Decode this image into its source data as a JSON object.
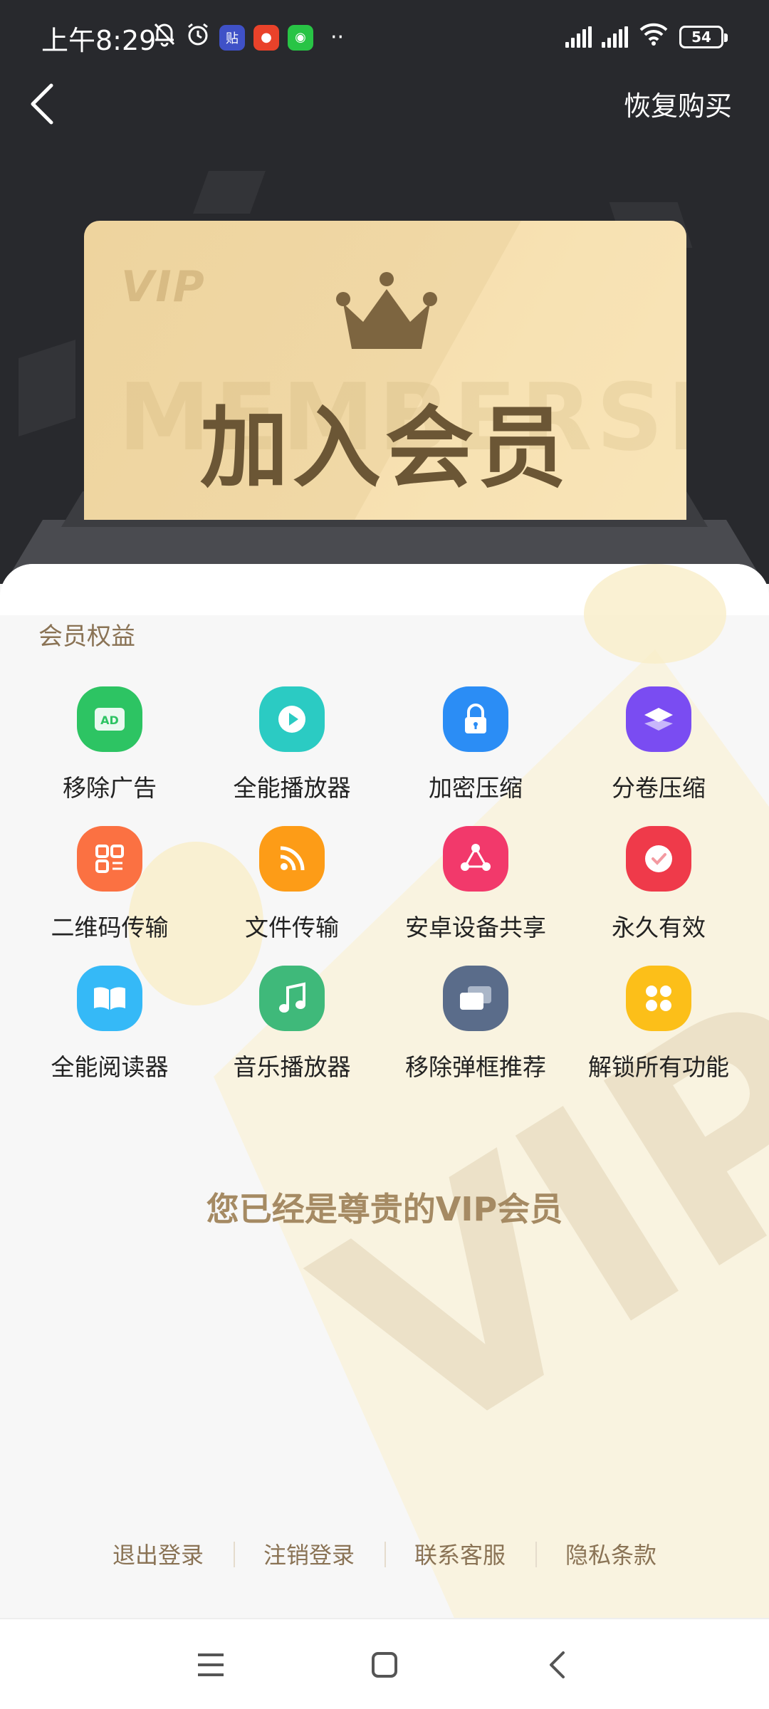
{
  "status_bar": {
    "time": "上午8:29",
    "battery": "54",
    "app_icons": [
      "bell-off-icon",
      "alarm-icon",
      "tieba-icon",
      "game-icon",
      "wechat-icon"
    ],
    "more": "··"
  },
  "header": {
    "restore_label": "恢复购买"
  },
  "vip_card": {
    "tag": "VIP",
    "watermark": "MEMBERSHIP",
    "title": "加入会员"
  },
  "benefits": {
    "title": "会员权益",
    "items": [
      {
        "label": "移除广告",
        "icon": "ad-icon",
        "color": "#2dc463"
      },
      {
        "label": "全能播放器",
        "icon": "play-icon",
        "color": "#2bcbc3"
      },
      {
        "label": "加密压缩",
        "icon": "lock-icon",
        "color": "#2b8df5"
      },
      {
        "label": "分卷压缩",
        "icon": "layers-icon",
        "color": "#7a4cf2"
      },
      {
        "label": "二维码传输",
        "icon": "qr-code-icon",
        "color": "#fb7142"
      },
      {
        "label": "文件传输",
        "icon": "rss-icon",
        "color": "#fd9c17"
      },
      {
        "label": "安卓设备共享",
        "icon": "share-icon",
        "color": "#f2396b"
      },
      {
        "label": "永久有效",
        "icon": "check-icon",
        "color": "#ef3a4a"
      },
      {
        "label": "全能阅读器",
        "icon": "book-icon",
        "color": "#35b9f7"
      },
      {
        "label": "音乐播放器",
        "icon": "music-icon",
        "color": "#3fb97a"
      },
      {
        "label": "移除弹框推荐",
        "icon": "window-icon",
        "color": "#5a6c8a"
      },
      {
        "label": "解锁所有功能",
        "icon": "grid-icon",
        "color": "#fcbf19"
      }
    ]
  },
  "vip_status": "您已经是尊贵的VIP会员",
  "footer": {
    "links": [
      "退出登录",
      "注销登录",
      "联系客服",
      "隐私条款"
    ]
  },
  "colors": {
    "header_bg": "#28292d",
    "card_gold": "#eed49e",
    "accent_brown": "#8a7355"
  }
}
